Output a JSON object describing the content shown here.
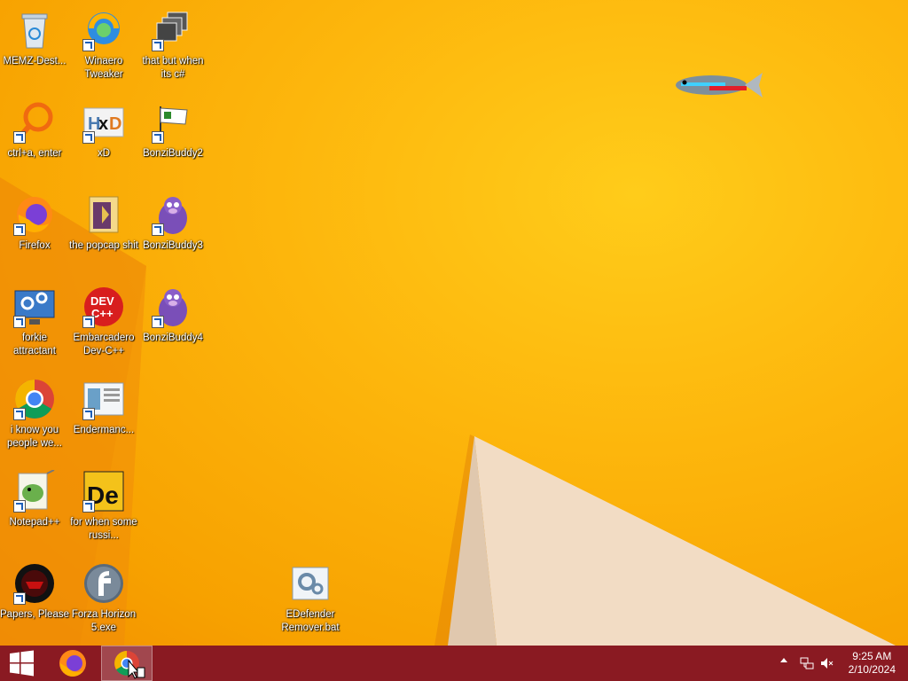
{
  "desktop": {
    "icons": [
      {
        "label": "MEMZ-Dest...",
        "icon": "recycle-bin-icon"
      },
      {
        "label": "Winaero Tweaker",
        "icon": "winaero-icon"
      },
      {
        "label": "that but when its c#",
        "icon": "stacked-windows-icon"
      },
      {
        "label": "ctrl+a, enter",
        "icon": "magnifier-icon"
      },
      {
        "label": "xD",
        "icon": "hxd-icon"
      },
      {
        "label": "BonziBuddy2",
        "icon": "flag-icon"
      },
      {
        "label": "Firefox",
        "icon": "firefox-icon"
      },
      {
        "label": "the popcap shit",
        "icon": "folder-icon"
      },
      {
        "label": "BonziBuddy3",
        "icon": "bonzi-icon"
      },
      {
        "label": "forkie attractant",
        "icon": "settings-monitor-icon"
      },
      {
        "label": "Embarcadero Dev-C++",
        "icon": "devcpp-icon"
      },
      {
        "label": "BonziBuddy4",
        "icon": "bonzi-icon"
      },
      {
        "label": "i know you people we...",
        "icon": "chrome-icon"
      },
      {
        "label": "Endermanc...",
        "icon": "window-doc-icon"
      },
      {
        "label": "Notepad++",
        "icon": "notepadpp-icon"
      },
      {
        "label": "for when some russi...",
        "icon": "de-icon"
      },
      {
        "label": "Papers, Please",
        "icon": "papers-please-icon"
      },
      {
        "label": "Forza Horizon 5.exe",
        "icon": "flash-icon"
      },
      {
        "label": "EDefender Remover.bat",
        "icon": "batch-file-icon"
      }
    ]
  },
  "taskbar": {
    "start_icon": "windows-logo-icon",
    "pinned": [
      "firefox-icon",
      "chrome-icon"
    ],
    "tray": {
      "time": "9:25 AM",
      "date": "2/10/2024"
    }
  },
  "colors": {
    "wallpaper": "#fdb60c",
    "taskbar": "#8a1a22"
  }
}
